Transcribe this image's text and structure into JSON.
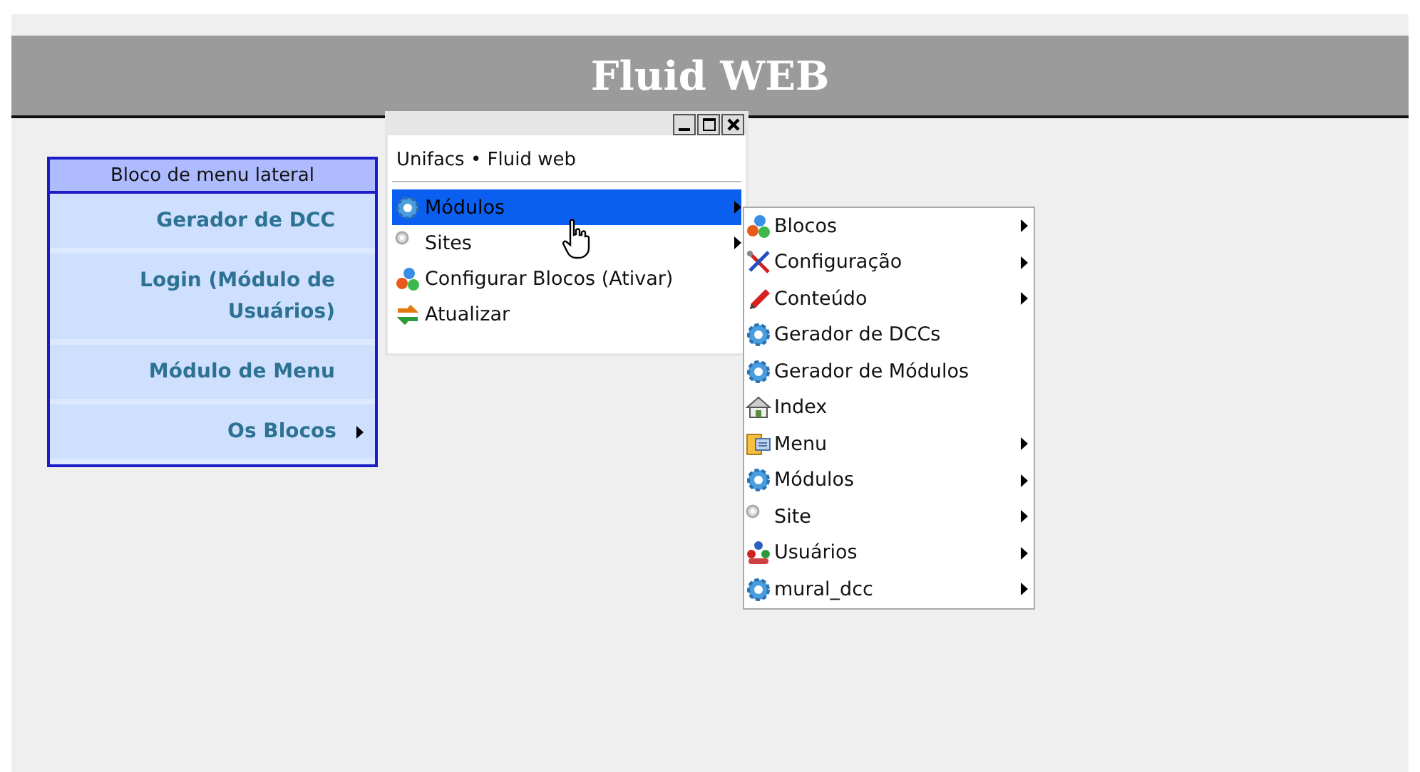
{
  "header": {
    "title": "Fluid WEB"
  },
  "sidebar": {
    "title": "Bloco de menu lateral",
    "items": [
      {
        "label": "Gerador de DCC",
        "has_submenu": false
      },
      {
        "label": "Login (Módulo de Usuários)",
        "has_submenu": false
      },
      {
        "label": "Módulo de Menu",
        "has_submenu": false
      },
      {
        "label": "Os Blocos",
        "has_submenu": true
      }
    ]
  },
  "popup": {
    "heading": "Unifacs • Fluid web",
    "items": [
      {
        "label": "Módulos",
        "kind": "gear",
        "has_submenu": true,
        "selected": true
      },
      {
        "label": "Sites",
        "kind": "small-gear",
        "has_submenu": true,
        "selected": false
      },
      {
        "label": "Configurar Blocos (Ativar)",
        "kind": "blocks",
        "has_submenu": false,
        "selected": false
      },
      {
        "label": "Atualizar",
        "kind": "refresh",
        "has_submenu": false,
        "selected": false
      }
    ]
  },
  "submenu": {
    "items": [
      {
        "label": "Blocos",
        "kind": "blocks",
        "has_submenu": true
      },
      {
        "label": "Configuração",
        "kind": "tools",
        "has_submenu": true
      },
      {
        "label": "Conteúdo",
        "kind": "pencil",
        "has_submenu": true
      },
      {
        "label": "Gerador de DCCs",
        "kind": "gear",
        "has_submenu": false
      },
      {
        "label": "Gerador de Módulos",
        "kind": "gear",
        "has_submenu": false
      },
      {
        "label": "Index",
        "kind": "house",
        "has_submenu": false
      },
      {
        "label": "Menu",
        "kind": "menu",
        "has_submenu": true
      },
      {
        "label": "Módulos",
        "kind": "gear",
        "has_submenu": true
      },
      {
        "label": "Site",
        "kind": "small-gear",
        "has_submenu": true
      },
      {
        "label": "Usuários",
        "kind": "users",
        "has_submenu": true
      },
      {
        "label": "mural_dcc",
        "kind": "gear",
        "has_submenu": true
      }
    ]
  }
}
